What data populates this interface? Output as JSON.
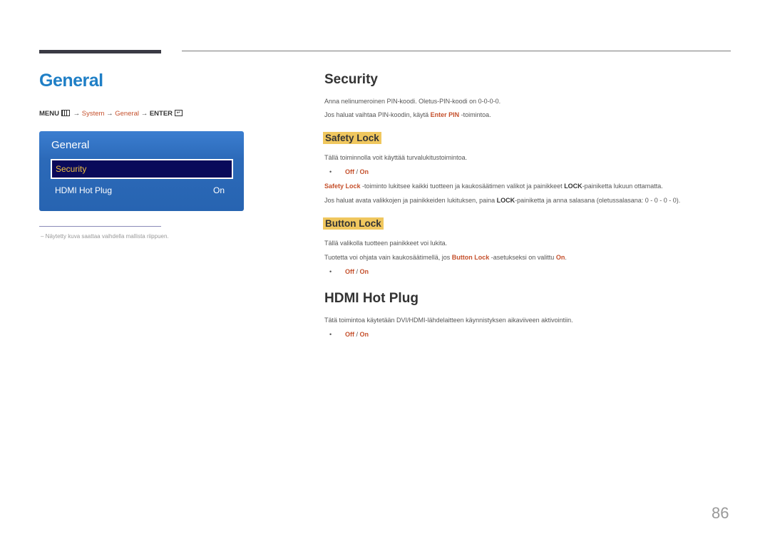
{
  "left": {
    "title": "General",
    "breadcrumb": {
      "menu": "MENU",
      "arrow": "→",
      "system": "System",
      "general": "General",
      "enter": "ENTER",
      "enter_glyph": "↵"
    },
    "osd": {
      "title": "General",
      "items": [
        {
          "label": "Security",
          "value": ""
        },
        {
          "label": "HDMI Hot Plug",
          "value": "On"
        }
      ]
    },
    "note": "–  Näytetty kuva saattaa vaihdella mallista riippuen."
  },
  "security": {
    "title": "Security",
    "line1": "Anna nelinumeroinen PIN-koodi. Oletus-PIN-koodi on 0-0-0-0.",
    "line2_pre": "Jos haluat vaihtaa PIN-koodin, käytä ",
    "line2_hl": "Enter PIN",
    "line2_post": " -toimintoa."
  },
  "safety_lock": {
    "title": "Safety Lock",
    "desc": "Tällä toiminnolla voit käyttää turvalukitustoimintoa.",
    "off": "Off",
    "sep": " / ",
    "on": "On",
    "line1_hl": "Safety Lock",
    "line1_mid": " -toiminto lukitsee kaikki tuotteen ja kaukosäätimen valikot ja painikkeet ",
    "line1_bold": "LOCK",
    "line1_post": "-painiketta lukuun ottamatta.",
    "line2_pre": "Jos haluat avata valikkojen ja painikkeiden lukituksen, paina ",
    "line2_bold": "LOCK",
    "line2_post": "-painiketta ja anna salasana (oletussalasana: 0 - 0 - 0 - 0)."
  },
  "button_lock": {
    "title": "Button Lock",
    "desc": "Tällä valikolla tuotteen painikkeet voi lukita.",
    "line2_pre": "Tuotetta voi ohjata vain kaukosäätimellä, jos ",
    "line2_hl": "Button Lock",
    "line2_mid": " -asetukseksi on valittu ",
    "line2_on": "On",
    "line2_post": ".",
    "off": "Off",
    "sep": " / ",
    "on": "On"
  },
  "hdmi": {
    "title": "HDMI Hot Plug",
    "desc": "Tätä toimintoa käytetään DVI/HDMI-lähdelaitteen käynnistyksen aikaviiveen aktivointiin.",
    "off": "Off",
    "sep": " / ",
    "on": "On"
  },
  "page_number": "86",
  "bullet": "•"
}
